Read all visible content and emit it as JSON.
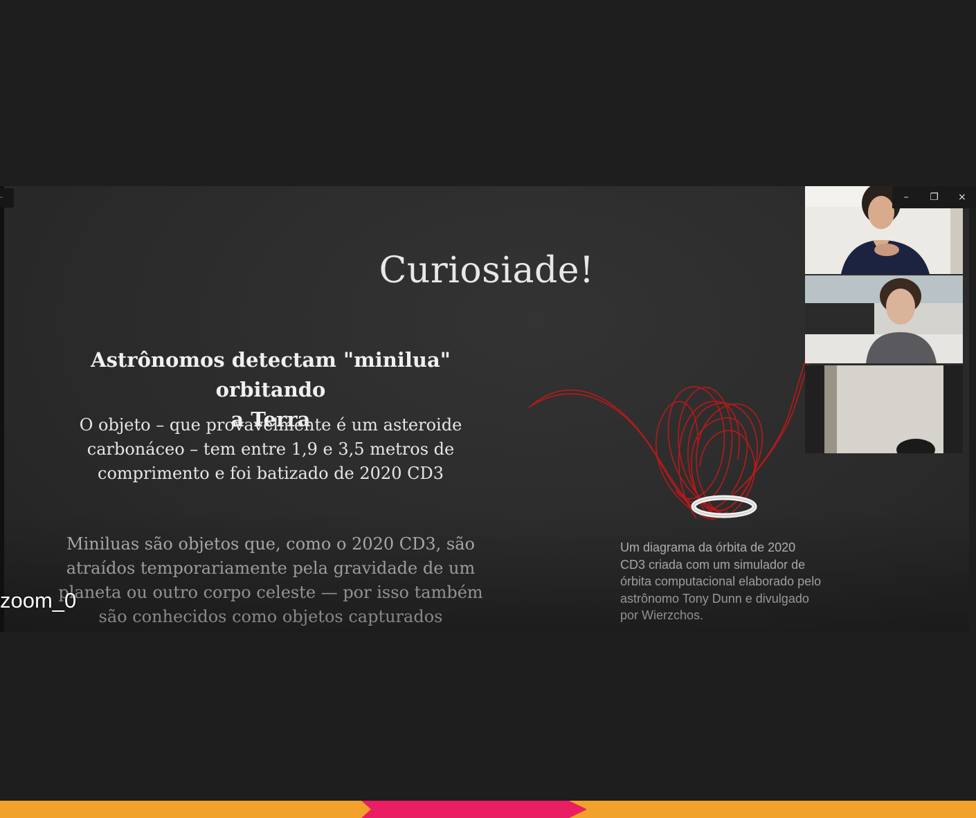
{
  "slide": {
    "title": "Curiosiade!",
    "headline_line1": "Astrônomos detectam \"minilua\" orbitando",
    "headline_line2": "a Terra",
    "para1_lines": [
      "O objeto – que provavelmente é um asteroide",
      "carbonáceo – tem entre 1,9 e 3,5 metros de",
      "comprimento e foi batizado de 2020 CD3"
    ],
    "para2_lines": [
      "Miniluas são objetos que, como o 2020 CD3, são",
      "atraídos temporariamente pela gravidade de um",
      "planeta ou outro corpo celeste — por isso também",
      "são conhecidos como objetos capturados"
    ],
    "caption_lines": [
      "Um diagrama da órbita de 2020",
      "CD3 criada com um simulador de",
      "órbita computacional elaborado pelo",
      "astrônomo Tony Dunn e divulgado",
      "por Wierzchos."
    ]
  },
  "zoom_label": "zoom_0",
  "window_controls": {
    "minimize": "–",
    "restore": "❐",
    "close": "×"
  },
  "colors": {
    "background": "#1e1e1e",
    "slide": "#2a2a2a",
    "orbit": "#c01818",
    "bottom_bar": "#f2a12b",
    "bottom_arrow": "#e91e63"
  },
  "icons": [
    "minimize-icon",
    "restore-icon",
    "close-icon",
    "orbit-diagram"
  ]
}
